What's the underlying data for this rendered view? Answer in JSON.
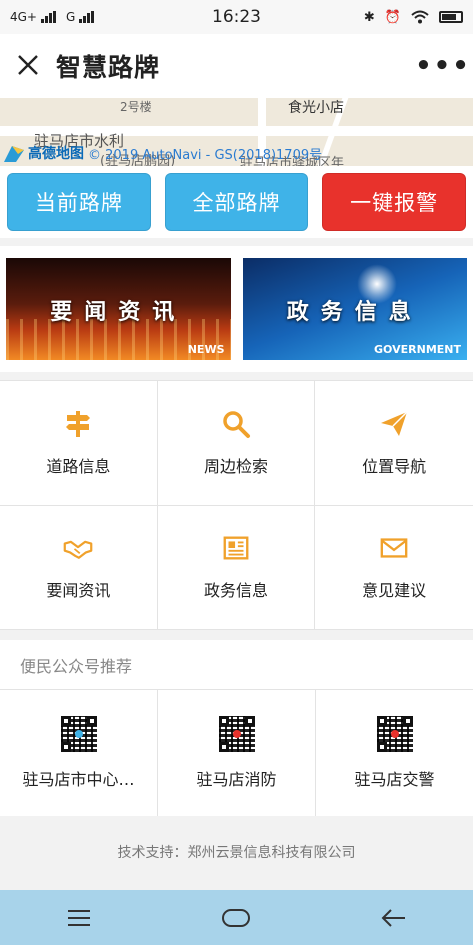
{
  "status_bar": {
    "network_1": "4G+",
    "network_2": "G",
    "time": "16:23"
  },
  "title_bar": {
    "title": "智慧路牌",
    "more": "•••"
  },
  "map": {
    "label_building": "2号楼",
    "label_shop": "食光小店",
    "label_area_1": "驻马店市水利",
    "label_area_2": "驻马店市驿城区年",
    "label_area_3": "(驻马店鹏园)",
    "provider": "高德地图",
    "copyright": "© 2019 AutoNavi - GS(2018)1709号"
  },
  "actions": {
    "current_sign": "当前路牌",
    "all_signs": "全部路牌",
    "alarm": "一键报警"
  },
  "banners": {
    "news_title": "要闻资讯",
    "news_tag": "NEWS",
    "gov_title": "政务信息",
    "gov_tag": "GOVERNMENT"
  },
  "grid": [
    {
      "label": "道路信息",
      "icon": "signpost-icon"
    },
    {
      "label": "周边检索",
      "icon": "search-icon"
    },
    {
      "label": "位置导航",
      "icon": "paper-plane-icon"
    },
    {
      "label": "要闻资讯",
      "icon": "handshake-icon"
    },
    {
      "label": "政务信息",
      "icon": "newspaper-icon"
    },
    {
      "label": "意见建议",
      "icon": "envelope-icon"
    }
  ],
  "recommend": {
    "heading": "便民公众号推荐",
    "items": [
      {
        "name": "驻马店市中心…"
      },
      {
        "name": "驻马店消防"
      },
      {
        "name": "驻马店交警"
      }
    ]
  },
  "footer": {
    "support": "技术支持：郑州云景信息科技有限公司"
  },
  "colors": {
    "accent_blue": "#3fb3e8",
    "alarm_red": "#e8322c",
    "icon_orange": "#f0a12b",
    "nav_bar": "#a8d3ea"
  }
}
